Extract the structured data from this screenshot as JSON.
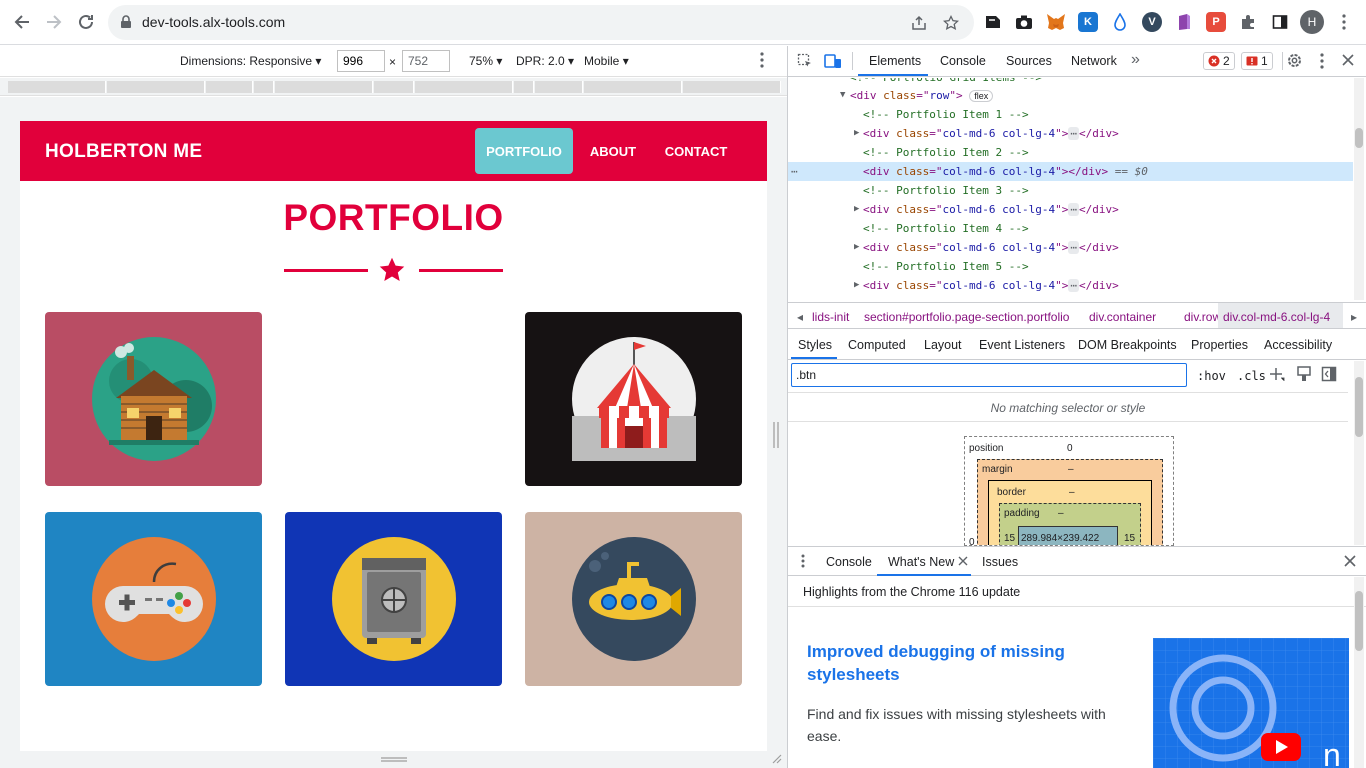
{
  "browser": {
    "url": "dev-tools.alx-tools.com",
    "avatar_letter": "H"
  },
  "device_toolbar": {
    "dimensions_label": "Dimensions: Responsive",
    "width_value": "996",
    "height_value": "752",
    "times": "×",
    "zoom": "75%",
    "dpr": "DPR: 2.0",
    "mode": "Mobile"
  },
  "site": {
    "brand": "HOLBERTON ME",
    "menu": [
      "PORTFOLIO",
      "ABOUT",
      "CONTACT"
    ],
    "heading": "PORTFOLIO",
    "accent_color": "#e1003b",
    "tiles": [
      {
        "name": "cabin",
        "bg": "#b94d64"
      },
      {
        "name": "circus-tent",
        "bg": "#161213"
      },
      {
        "name": "game-controller",
        "bg": "#1f85c3"
      },
      {
        "name": "safe",
        "bg": "#1035b5"
      },
      {
        "name": "submarine",
        "bg": "#cdb3a4"
      }
    ]
  },
  "devtools": {
    "tabs": [
      "Elements",
      "Console",
      "Sources",
      "Network"
    ],
    "error_count": "2",
    "warning_count": "1",
    "code_lines": [
      {
        "indent": 60,
        "type": "partial",
        "text": "<!-- Portfolio Grid Items -->"
      },
      {
        "indent": 60,
        "type": "open",
        "tag": "div",
        "attr": "class",
        "value": "row",
        "badge": "flex"
      },
      {
        "indent": 74,
        "type": "comment",
        "text": "<!-- Portfolio Item 1 -->"
      },
      {
        "indent": 74,
        "type": "collapsed",
        "tag": "div",
        "attr": "class",
        "value": "col-md-6 col-lg-4"
      },
      {
        "indent": 74,
        "type": "comment",
        "text": "<!-- Portfolio Item 2 -->"
      },
      {
        "indent": 74,
        "type": "selected",
        "tag": "div",
        "attr": "class",
        "value": "col-md-6 col-lg-4",
        "suffix": " == $0"
      },
      {
        "indent": 74,
        "type": "comment",
        "text": "<!-- Portfolio Item 3 -->"
      },
      {
        "indent": 74,
        "type": "collapsed",
        "tag": "div",
        "attr": "class",
        "value": "col-md-6 col-lg-4"
      },
      {
        "indent": 74,
        "type": "comment",
        "text": "<!-- Portfolio Item 4 -->"
      },
      {
        "indent": 74,
        "type": "collapsed",
        "tag": "div",
        "attr": "class",
        "value": "col-md-6 col-lg-4"
      },
      {
        "indent": 74,
        "type": "comment",
        "text": "<!-- Portfolio Item 5 -->"
      },
      {
        "indent": 74,
        "type": "collapsed",
        "tag": "div",
        "attr": "class",
        "value": "col-md-6 col-lg-4"
      }
    ],
    "breadcrumbs": [
      "lids-init",
      "section#portfolio.page-section.portfolio",
      "div.container",
      "div.row",
      "div.col-md-6.col-lg-4"
    ],
    "subtabs": [
      "Styles",
      "Computed",
      "Layout",
      "Event Listeners",
      "DOM Breakpoints",
      "Properties",
      "Accessibility"
    ],
    "filter_value": ".btn",
    "hov": ":hov",
    "cls": ".cls",
    "no_match": "No matching selector or style",
    "box_model": {
      "position_label": "position",
      "position_value": "0",
      "margin_label": "margin",
      "margin_value": "–",
      "border_label": "border",
      "border_value": "–",
      "padding_label": "padding",
      "padding_value": "–",
      "left_pad": "15",
      "content_size": "289.984×239.422",
      "right_pad": "15",
      "outer_left": "0"
    },
    "drawer_tabs": [
      "Console",
      "What's New",
      "Issues"
    ],
    "whats_new": {
      "header": "Highlights from the Chrome 116 update",
      "title": "Improved debugging of missing stylesheets",
      "description": "Find and fix issues with missing stylesheets with ease."
    }
  }
}
